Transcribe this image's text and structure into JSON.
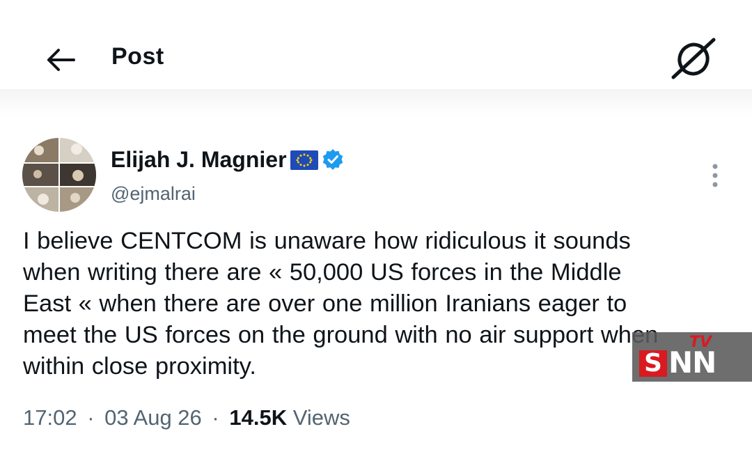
{
  "header": {
    "title": "Post",
    "back_icon": "arrow-left-icon",
    "grok_icon": "grok-icon"
  },
  "author": {
    "display_name": "Elijah J. Magnier",
    "handle": "@ejmalrai",
    "flag_icon": "eu-flag-icon",
    "verified_icon": "verified-badge-icon",
    "verified_color": "#1d9bf0"
  },
  "tweet": {
    "text": "I believe CENTCOM is unaware how ridiculous it sounds\nwhen writing there are « 50,000 US forces in the Middle\nEast «  when there are over one million Iranians eager to\nmeet the US forces on the ground with no air support when\nwithin close proximity."
  },
  "meta": {
    "time": "17:02",
    "date": "03 Aug 26",
    "views_count": "14.5K",
    "views_label": "Views",
    "separator": "·"
  },
  "watermark": {
    "s": "S",
    "nn": "NN",
    "tv": "TV"
  },
  "colors": {
    "text_primary": "#0f1419",
    "text_secondary": "#536471",
    "watermark_red": "#d91a21"
  }
}
